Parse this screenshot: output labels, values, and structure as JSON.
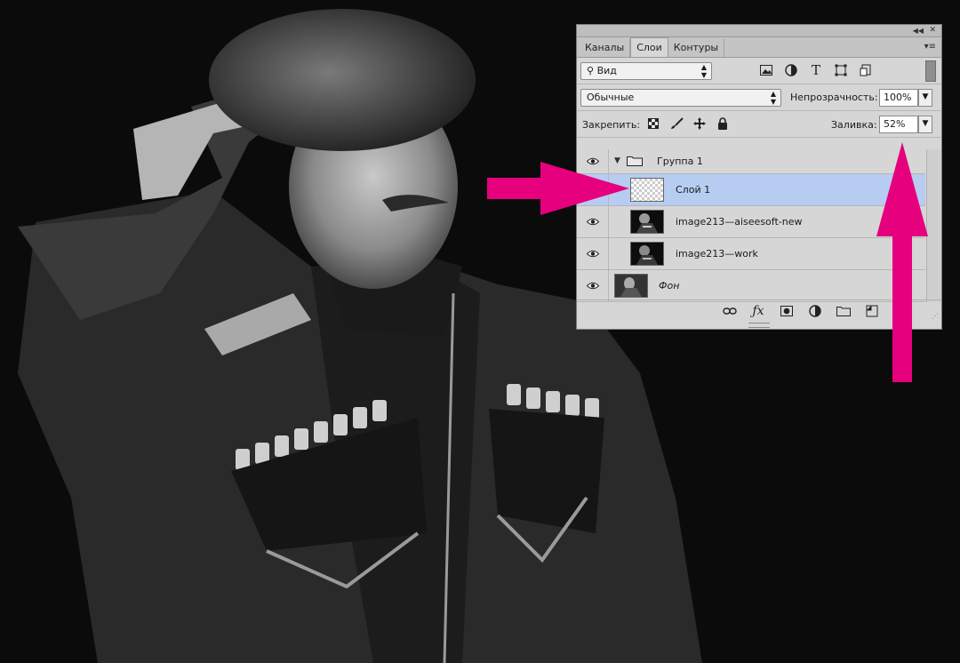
{
  "panel": {
    "tabs": [
      {
        "label": "Каналы",
        "active": false
      },
      {
        "label": "Слои",
        "active": true
      },
      {
        "label": "Контуры",
        "active": false
      }
    ],
    "filter": {
      "label": "Вид",
      "icon": "search-icon"
    },
    "blend_mode": "Обычные",
    "opacity": {
      "label": "Непрозрачность:",
      "value": "100%"
    },
    "lock": {
      "label": "Закрепить:"
    },
    "fill": {
      "label": "Заливка:",
      "value": "52%"
    },
    "layers": [
      {
        "name": "Группа 1",
        "type": "group",
        "visible": true,
        "expanded": true
      },
      {
        "name": "Слой 1",
        "type": "layer",
        "visible": false,
        "selected": true,
        "thumb": "transparent"
      },
      {
        "name": "image213—aiseesoft-new",
        "type": "layer",
        "visible": true
      },
      {
        "name": "image213—work",
        "type": "layer",
        "visible": true
      },
      {
        "name": "Фон",
        "type": "background",
        "visible": true
      }
    ]
  },
  "colors": {
    "panel_bg": "#d6d6d6",
    "selected_row": "#b6cdf1",
    "annotation_arrow": "#e6007e"
  }
}
